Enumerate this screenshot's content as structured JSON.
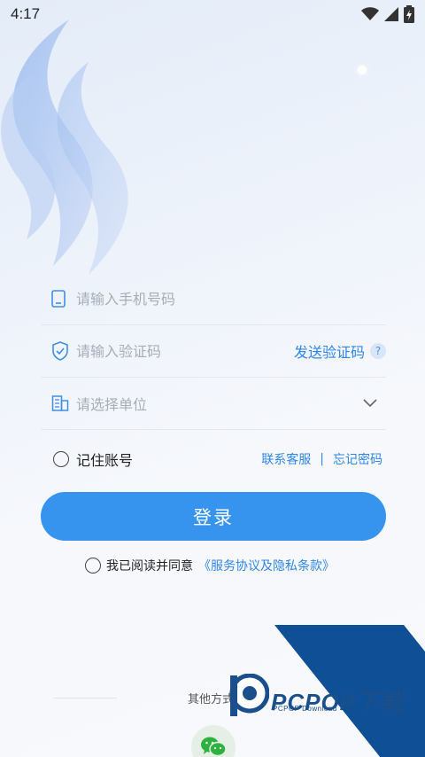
{
  "status_bar": {
    "time": "4:17"
  },
  "form": {
    "phone_placeholder": "请输入手机号码",
    "code_placeholder": "请输入验证码",
    "send_code_label": "发送验证码",
    "help_label": "?",
    "unit_placeholder": "请选择单位"
  },
  "remember_label": "记住账号",
  "links": {
    "contact": "联系客服",
    "separator": "|",
    "forgot": "忘记密码"
  },
  "login_label": "登录",
  "agreement": {
    "prefix": "我已阅读并同意",
    "link": "《服务协议及隐私条款》"
  },
  "other_methods_label": "其他方式",
  "watermark": {
    "brand": "PCPOP下载",
    "sub": "PCPOP Download"
  },
  "colors": {
    "accent": "#3794ee",
    "link": "#2f86e8"
  }
}
